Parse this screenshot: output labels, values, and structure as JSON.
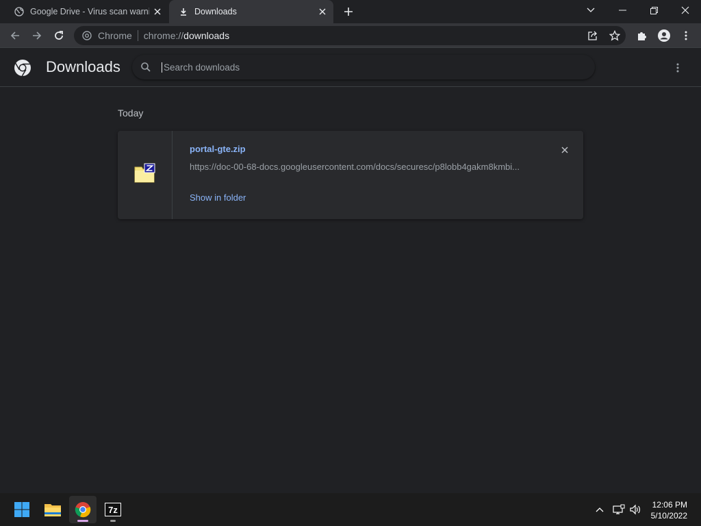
{
  "browser": {
    "tabs": [
      {
        "title": "Google Drive - Virus scan warning",
        "active": false
      },
      {
        "title": "Downloads",
        "active": true
      }
    ],
    "omnibox": {
      "site_label": "Chrome",
      "url_scheme": "chrome://",
      "url_host": "downloads"
    }
  },
  "downloads_page": {
    "title": "Downloads",
    "search_placeholder": "Search downloads",
    "section_date": "Today",
    "items": [
      {
        "file_name": "portal-gte.zip",
        "url": "https://doc-00-68-docs.googleusercontent.com/docs/securesc/p8lobb4gakm8kmbi...",
        "action_label": "Show in folder",
        "file_icon": "7zip-archive-icon"
      }
    ]
  },
  "taskbar": {
    "apps": [
      "windows-start-icon",
      "file-explorer-icon",
      "chrome-icon",
      "7zip-icon"
    ],
    "clock_time": "12:06 PM",
    "clock_date": "5/10/2022"
  },
  "colors": {
    "background": "#202124",
    "toolbar": "#35363a",
    "link": "#8ab4f8",
    "taskbar": "#1c1c1c"
  }
}
